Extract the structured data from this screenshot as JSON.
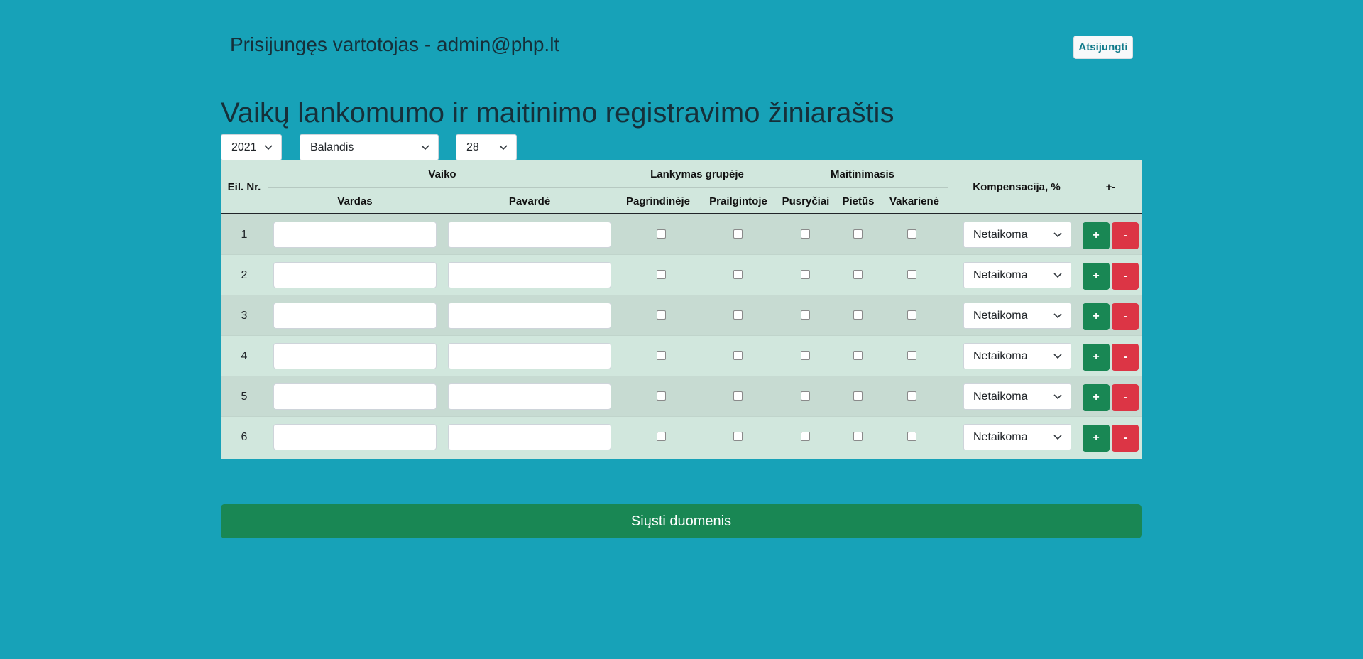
{
  "header": {
    "user_label": "Prisijungęs vartotojas - admin@php.lt",
    "logout_label": "Atsijungti"
  },
  "page_title": "Vaikų lankomumo ir maitinimo registravimo žiniaraštis",
  "filters": {
    "year": "2021",
    "month": "Balandis",
    "day": "28"
  },
  "table": {
    "headers": {
      "row_no": "Eil. Nr.",
      "child_group": "Vaiko",
      "first_name": "Vardas",
      "last_name": "Pavardė",
      "attendance_group": "Lankymas grupėje",
      "main_group": "Pagrindinėje",
      "extended_group": "Prailgintoje",
      "meals_group": "Maitinimasis",
      "breakfast": "Pusryčiai",
      "lunch": "Pietūs",
      "dinner": "Vakarienė",
      "compensation": "Kompensacija, %",
      "add_remove": "+-"
    },
    "rows": [
      {
        "num": "1",
        "compensation": "Netaikoma",
        "add": "+",
        "remove": "-"
      },
      {
        "num": "2",
        "compensation": "Netaikoma",
        "add": "+",
        "remove": "-"
      },
      {
        "num": "3",
        "compensation": "Netaikoma",
        "add": "+",
        "remove": "-"
      },
      {
        "num": "4",
        "compensation": "Netaikoma",
        "add": "+",
        "remove": "-"
      },
      {
        "num": "5",
        "compensation": "Netaikoma",
        "add": "+",
        "remove": "-"
      },
      {
        "num": "6",
        "compensation": "Netaikoma",
        "add": "+",
        "remove": "-"
      }
    ]
  },
  "submit_label": "Siųsti duomenis",
  "colors": {
    "background": "#17a2b8",
    "table_bg": "#d1e7dd",
    "success": "#198754",
    "danger": "#dc3545"
  }
}
